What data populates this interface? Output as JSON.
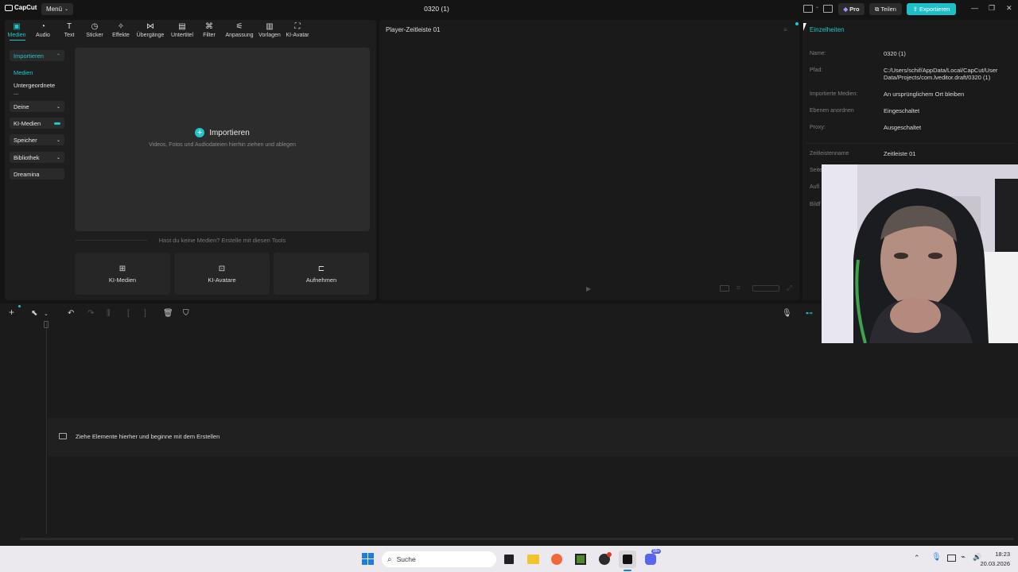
{
  "app": {
    "logo_text": "CapCut",
    "menu_label": "Menü",
    "document_title": "0320 (1)",
    "pro_label": "Pro",
    "share_label": "Teilen",
    "export_label": "Exportieren"
  },
  "toolbar": [
    {
      "label": "Medien",
      "icon": "media-icon",
      "active": true
    },
    {
      "label": "Audio",
      "icon": "audio-icon"
    },
    {
      "label": "Text",
      "icon": "text-icon"
    },
    {
      "label": "Sticker",
      "icon": "sticker-icon"
    },
    {
      "label": "Effekte",
      "icon": "effects-icon"
    },
    {
      "label": "Übergänge",
      "icon": "transitions-icon"
    },
    {
      "label": "Untertitel",
      "icon": "subtitles-icon"
    },
    {
      "label": "Filter",
      "icon": "filter-icon"
    },
    {
      "label": "Anpassung",
      "icon": "adjust-icon"
    },
    {
      "label": "Vorlagen",
      "icon": "templates-icon"
    },
    {
      "label": "KI-Avatar",
      "icon": "ai-avatar-icon"
    }
  ],
  "sidebar": [
    {
      "label": "Importieren",
      "caret": "up",
      "teal": true,
      "bg": true
    },
    {
      "label": "Medien",
      "teal": true
    },
    {
      "label": "Untergeordnete ..."
    },
    {
      "label": "Deine",
      "caret": "down",
      "bg": true
    },
    {
      "label": "KI-Medien",
      "bg": true,
      "toggle": true
    },
    {
      "label": "Speicher",
      "caret": "down",
      "bg": true
    },
    {
      "label": "Bibliothek",
      "caret": "down",
      "bg": true
    },
    {
      "label": "Dreamina",
      "bg": true
    }
  ],
  "import": {
    "title": "Importieren",
    "subtitle": "Videos, Fotos und Audiodateien hierhin ziehen und ablegen"
  },
  "tools_hint": "Hast du keine Medien? Erstelle mit diesen Tools",
  "tools": [
    {
      "label": "KI-Medien",
      "icon": "ai-media-icon"
    },
    {
      "label": "KI-Avatare",
      "icon": "ai-avatar-icon"
    },
    {
      "label": "Aufnehmen",
      "icon": "record-icon"
    }
  ],
  "player": {
    "title": "Player-Zeitleiste 01"
  },
  "details": {
    "heading": "Einzelheiten",
    "rows": [
      {
        "label": "Name:",
        "value": "0320 (1)"
      },
      {
        "label": "Pfad:",
        "value": "C:/Users/schif/AppData/Local/CapCut/User Data/Projects/com.lveditor.draft/0320 (1)"
      },
      {
        "label": "Importierte Medien:",
        "value": "An ursprünglichem Ort bleiben"
      },
      {
        "label": "Ebenen anordnen",
        "value": "Eingeschaltet"
      },
      {
        "label": "Proxy:",
        "value": "Ausgeschaltet"
      },
      {
        "label": "Zeitleistenname",
        "value": "Zeitleiste 01"
      }
    ],
    "partial_labels": [
      "Seite",
      "Aufl",
      "Bildf"
    ]
  },
  "timeline": {
    "empty_hint": "Ziehe Elemente hierher und beginne mit dem Erstellen"
  },
  "taskbar": {
    "search_label": "Suche",
    "time": "18:23",
    "date": "20.03.2026",
    "notification_badge": "99+"
  },
  "colors": {
    "accent": "#21c5cc",
    "export": "#1fbfc9",
    "panel": "#1e1e1e",
    "background": "#141414"
  }
}
